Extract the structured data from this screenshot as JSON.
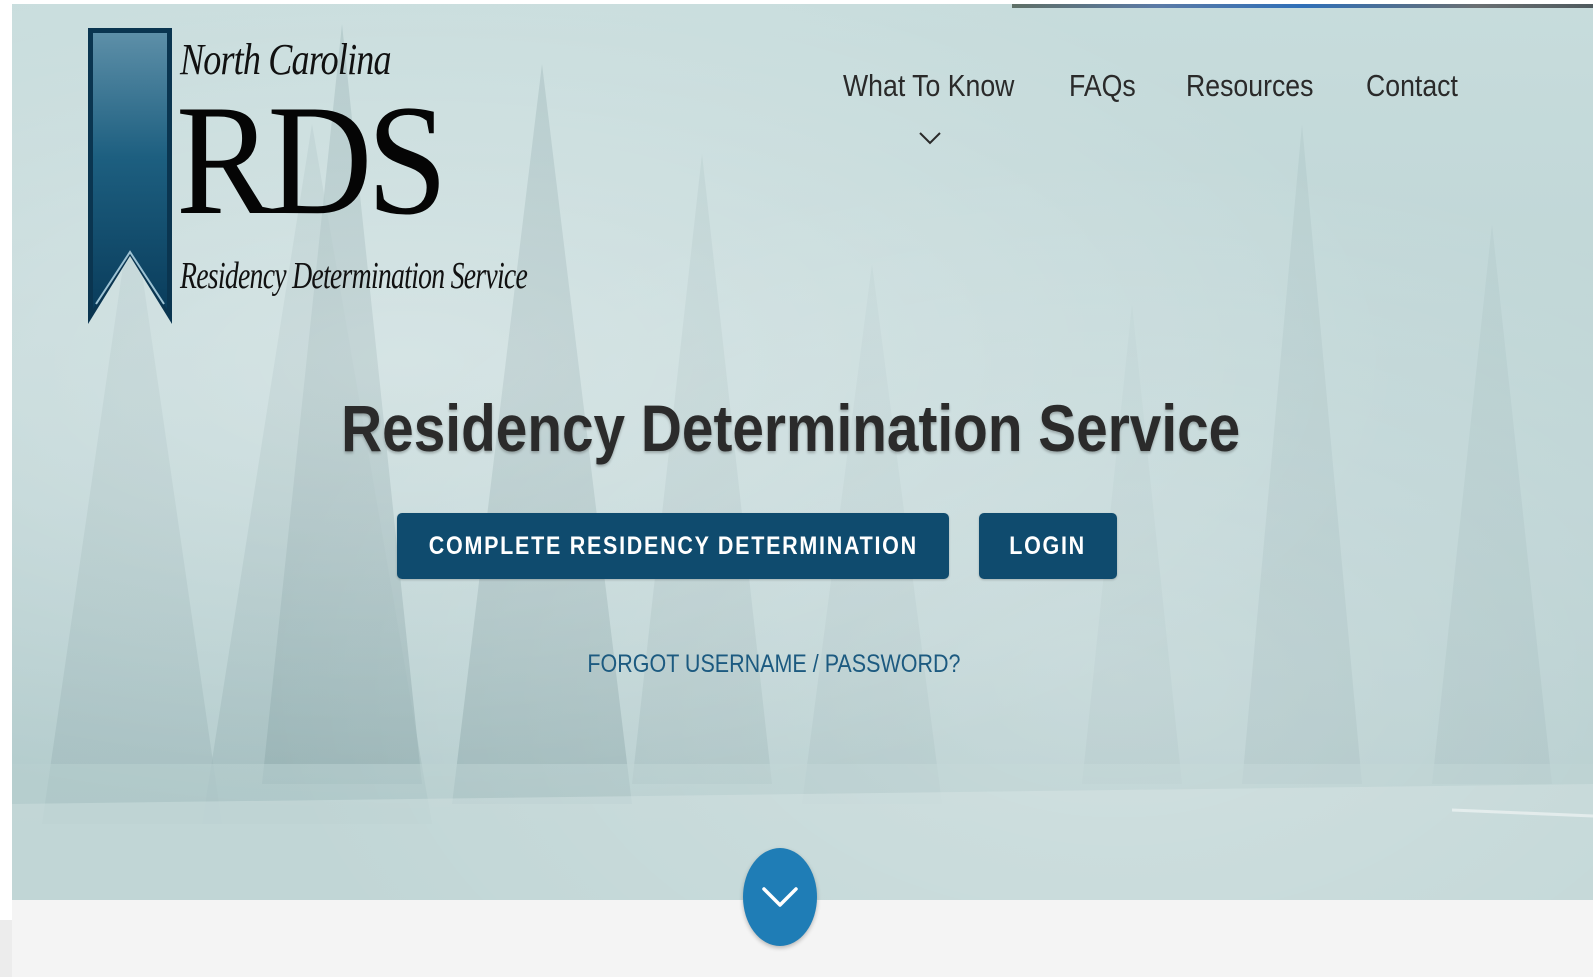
{
  "logo": {
    "line1": "North Carolina",
    "acronym": "RDS",
    "line3": "Residency Determination Service",
    "ribbon_color": "#0f4b6e"
  },
  "nav": {
    "items": [
      {
        "label": "What To Know",
        "has_dropdown": true
      },
      {
        "label": "FAQs"
      },
      {
        "label": "Resources"
      },
      {
        "label": "Contact"
      }
    ],
    "dropdown_icon": "chevron-down-icon"
  },
  "hero": {
    "title": "Residency Determination Service",
    "primary_button": "COMPLETE RESIDENCY DETERMINATION",
    "login_button": "LOGIN",
    "forgot_link": "FORGOT USERNAME / PASSWORD?",
    "scroll_icon": "chevron-down-icon"
  },
  "colors": {
    "button_bg": "#0f4b6e",
    "link": "#1c5a80",
    "scroll_button": "#1f7db6"
  }
}
